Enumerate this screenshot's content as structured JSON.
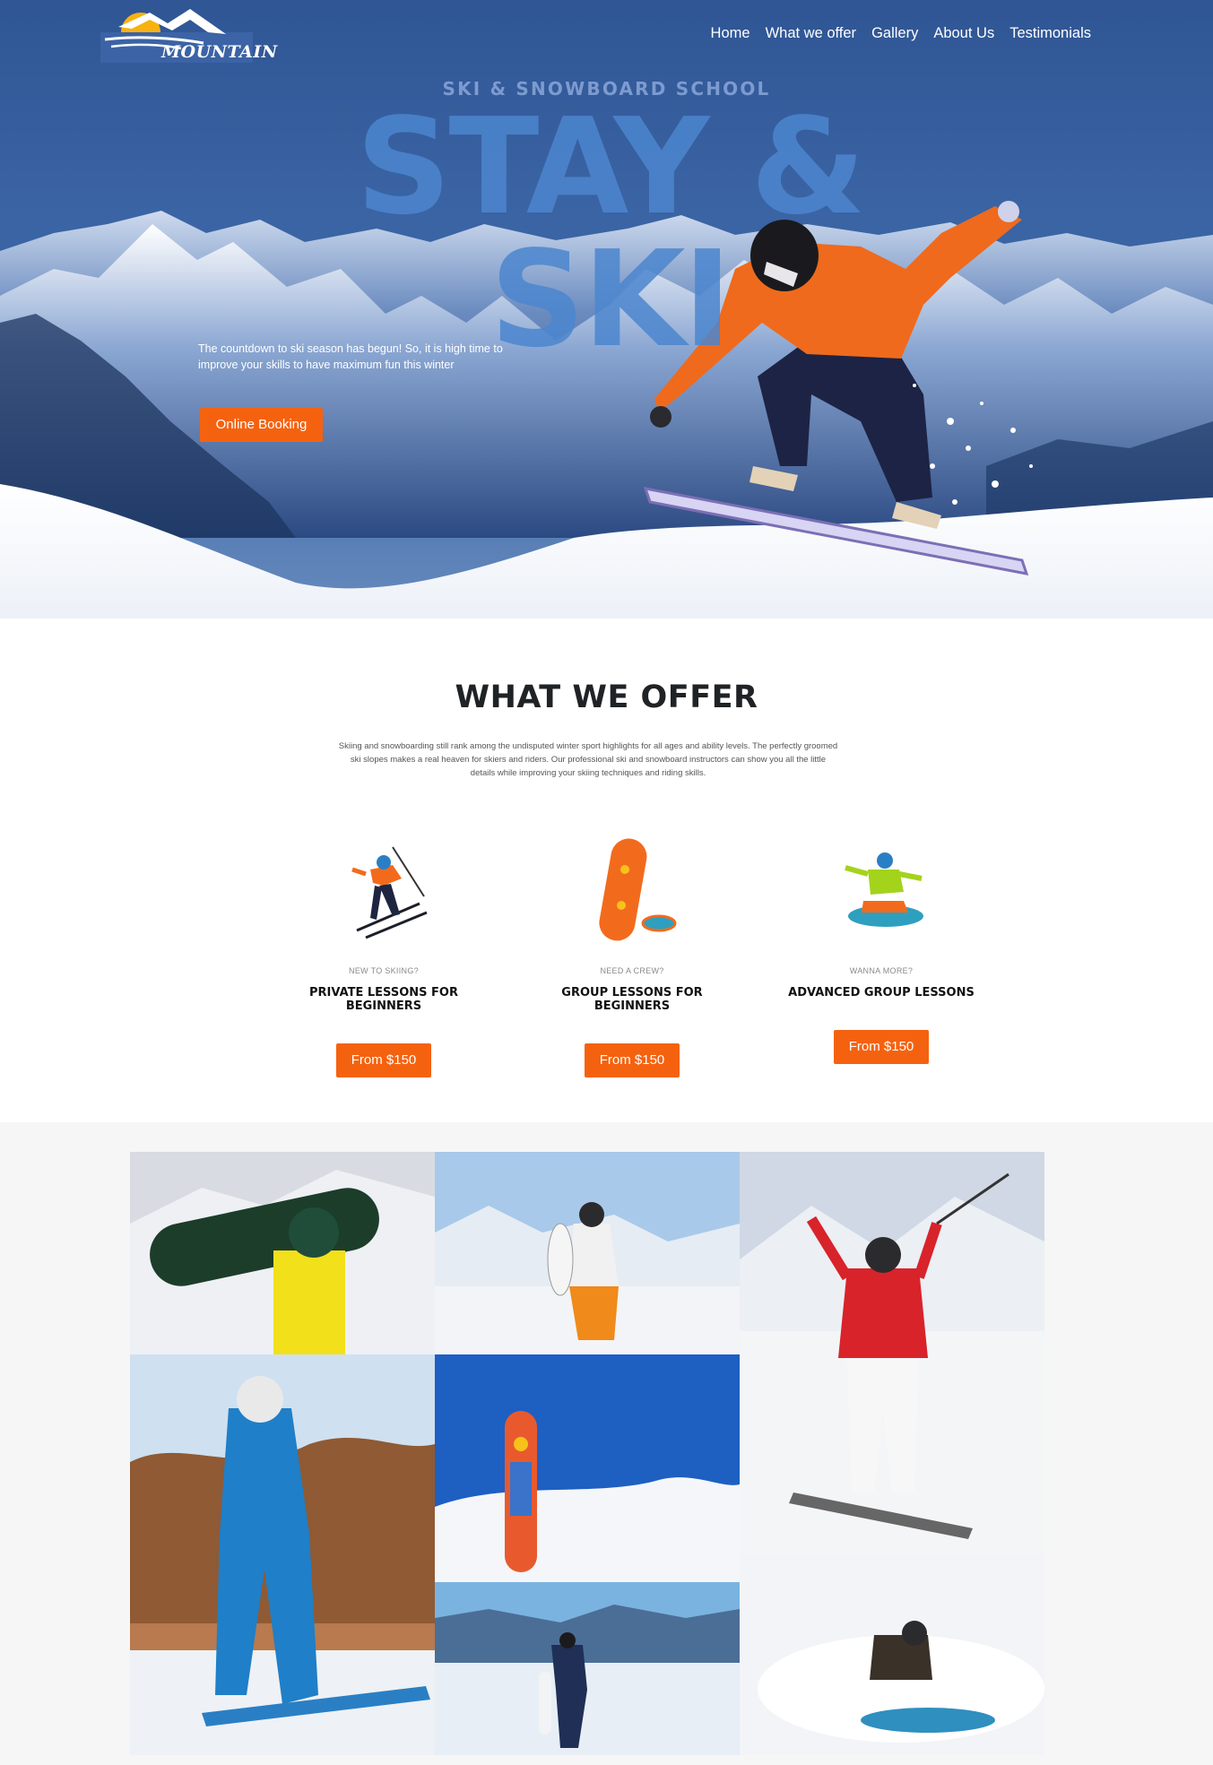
{
  "header": {
    "logo_text": "MOUNTAIN",
    "nav": [
      "Home",
      "What we offer",
      "Gallery",
      "About Us",
      "Testimonials"
    ]
  },
  "hero": {
    "subtitle": "SKI & SNOWBOARD SCHOOL",
    "title": "STAY & SKI",
    "text": "The countdown to ski season has begun! So, it is high time to improve your skills to have maximum fun this winter",
    "button": "Online Booking"
  },
  "offer": {
    "title": "WHAT WE OFFER",
    "description": "Skiing and snowboarding still rank among the undisputed winter sport highlights for all ages and ability levels. The perfectly groomed ski slopes makes a real heaven for skiers and riders. Our professional ski and snowboard instructors can show you all the little details while improving your skiing techniques and riding skills.",
    "cards": [
      {
        "kicker": "NEW TO SKIING?",
        "name": "PRIVATE LESSONS FOR BEGINNERS",
        "price": "From $150",
        "icon": "skier-icon"
      },
      {
        "kicker": "NEED A CREW?",
        "name": "GROUP LESSONS FOR BEGINNERS",
        "price": "From $150",
        "icon": "snowboard-goggles-icon"
      },
      {
        "kicker": "WANNA MORE?",
        "name": "ADVANCED GROUP LESSONS",
        "price": "From $150",
        "icon": "snowboarder-icon"
      }
    ]
  },
  "colors": {
    "accent": "#f5620f",
    "hero_blue": "#2f5594",
    "gallery_bg": "#f6f6f6"
  }
}
